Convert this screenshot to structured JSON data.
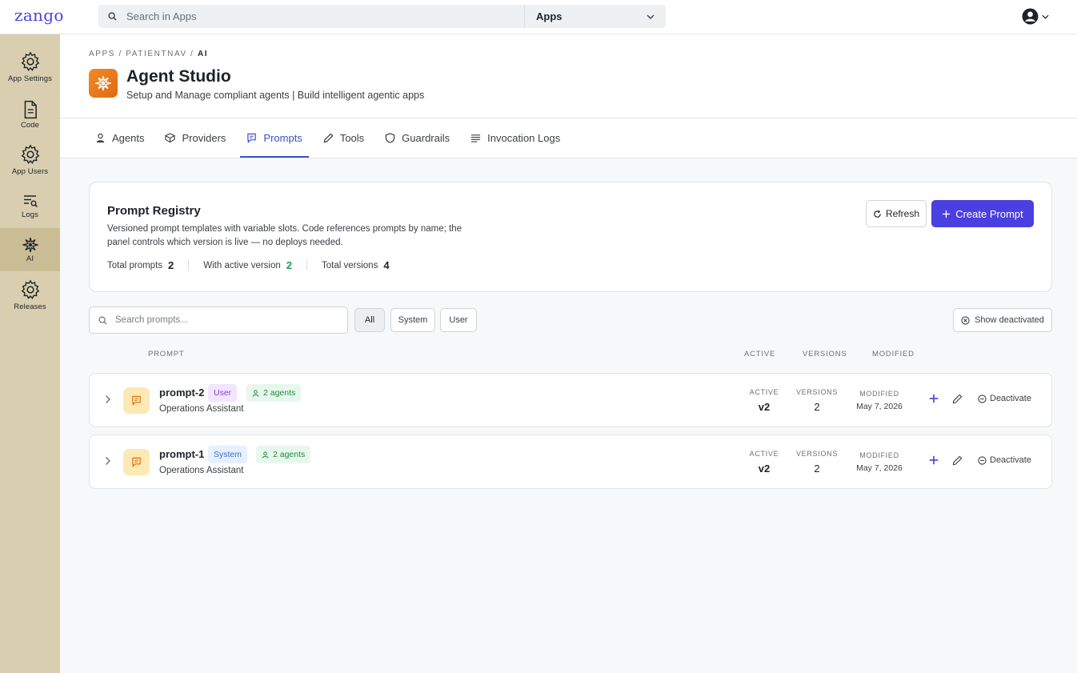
{
  "topbar": {
    "logo": "zango",
    "search_placeholder": "Search in Apps",
    "app_select": "Apps"
  },
  "sidebar": {
    "items": [
      {
        "label": "App Settings",
        "icon": "gear-icon"
      },
      {
        "label": "Code",
        "icon": "file-icon"
      },
      {
        "label": "App Users",
        "icon": "gear-icon"
      },
      {
        "label": "Logs",
        "icon": "logs-search-icon"
      },
      {
        "label": "AI",
        "icon": "sparkle-icon",
        "active": true
      },
      {
        "label": "Releases",
        "icon": "gear-icon"
      }
    ]
  },
  "header": {
    "breadcrumb": {
      "part1": "APPS",
      "part2": "PATIENTNAV",
      "current": "AI"
    },
    "title": "Agent Studio",
    "subtitle": "Setup and Manage compliant agents | Build intelligent agentic apps",
    "tabs": [
      {
        "label": "Agents",
        "icon": "user-icon"
      },
      {
        "label": "Providers",
        "icon": "box-icon"
      },
      {
        "label": "Prompts",
        "icon": "chat-icon",
        "active": true
      },
      {
        "label": "Tools",
        "icon": "pencil-icon"
      },
      {
        "label": "Guardrails",
        "icon": "shield-icon"
      },
      {
        "label": "Invocation Logs",
        "icon": "list-icon"
      }
    ]
  },
  "registry": {
    "title": "Prompt Registry",
    "description": "Versioned prompt templates with variable slots. Code references prompts by name; the panel controls which version is live — no deploys needed.",
    "stats": {
      "total_label": "Total prompts",
      "total_value": "2",
      "active_label": "With active version",
      "active_value": "2",
      "versions_label": "Total versions",
      "versions_value": "4"
    },
    "refresh_label": "Refresh",
    "create_label": "Create Prompt"
  },
  "filters": {
    "search_placeholder": "Search prompts...",
    "all": "All",
    "system": "System",
    "user": "User",
    "show_deactivated": "Show deactivated"
  },
  "columns": {
    "prompt": "PROMPT",
    "active": "ACTIVE",
    "versions": "VERSIONS",
    "modified": "MODIFIED"
  },
  "prompts": [
    {
      "name": "prompt-2",
      "type": "User",
      "agents": "2 agents",
      "agent_name": "Operations Assistant",
      "active_label": "ACTIVE",
      "active": "v2",
      "versions_label": "VERSIONS",
      "versions": "2",
      "modified_label": "MODIFIED",
      "modified": "May 7, 2026",
      "deactivate_label": "Deactivate"
    },
    {
      "name": "prompt-1",
      "type": "System",
      "agents": "2 agents",
      "agent_name": "Operations Assistant",
      "active_label": "ACTIVE",
      "active": "v2",
      "versions_label": "VERSIONS",
      "versions": "2",
      "modified_label": "MODIFIED",
      "modified": "May 7, 2026",
      "deactivate_label": "Deactivate"
    }
  ],
  "colors": {
    "accent": "#4a3fe0",
    "tab_active": "#3b50c9",
    "sidebar_bg": "#d9cfb0",
    "sidebar_active": "#cabd95",
    "success": "#1f9d55"
  }
}
